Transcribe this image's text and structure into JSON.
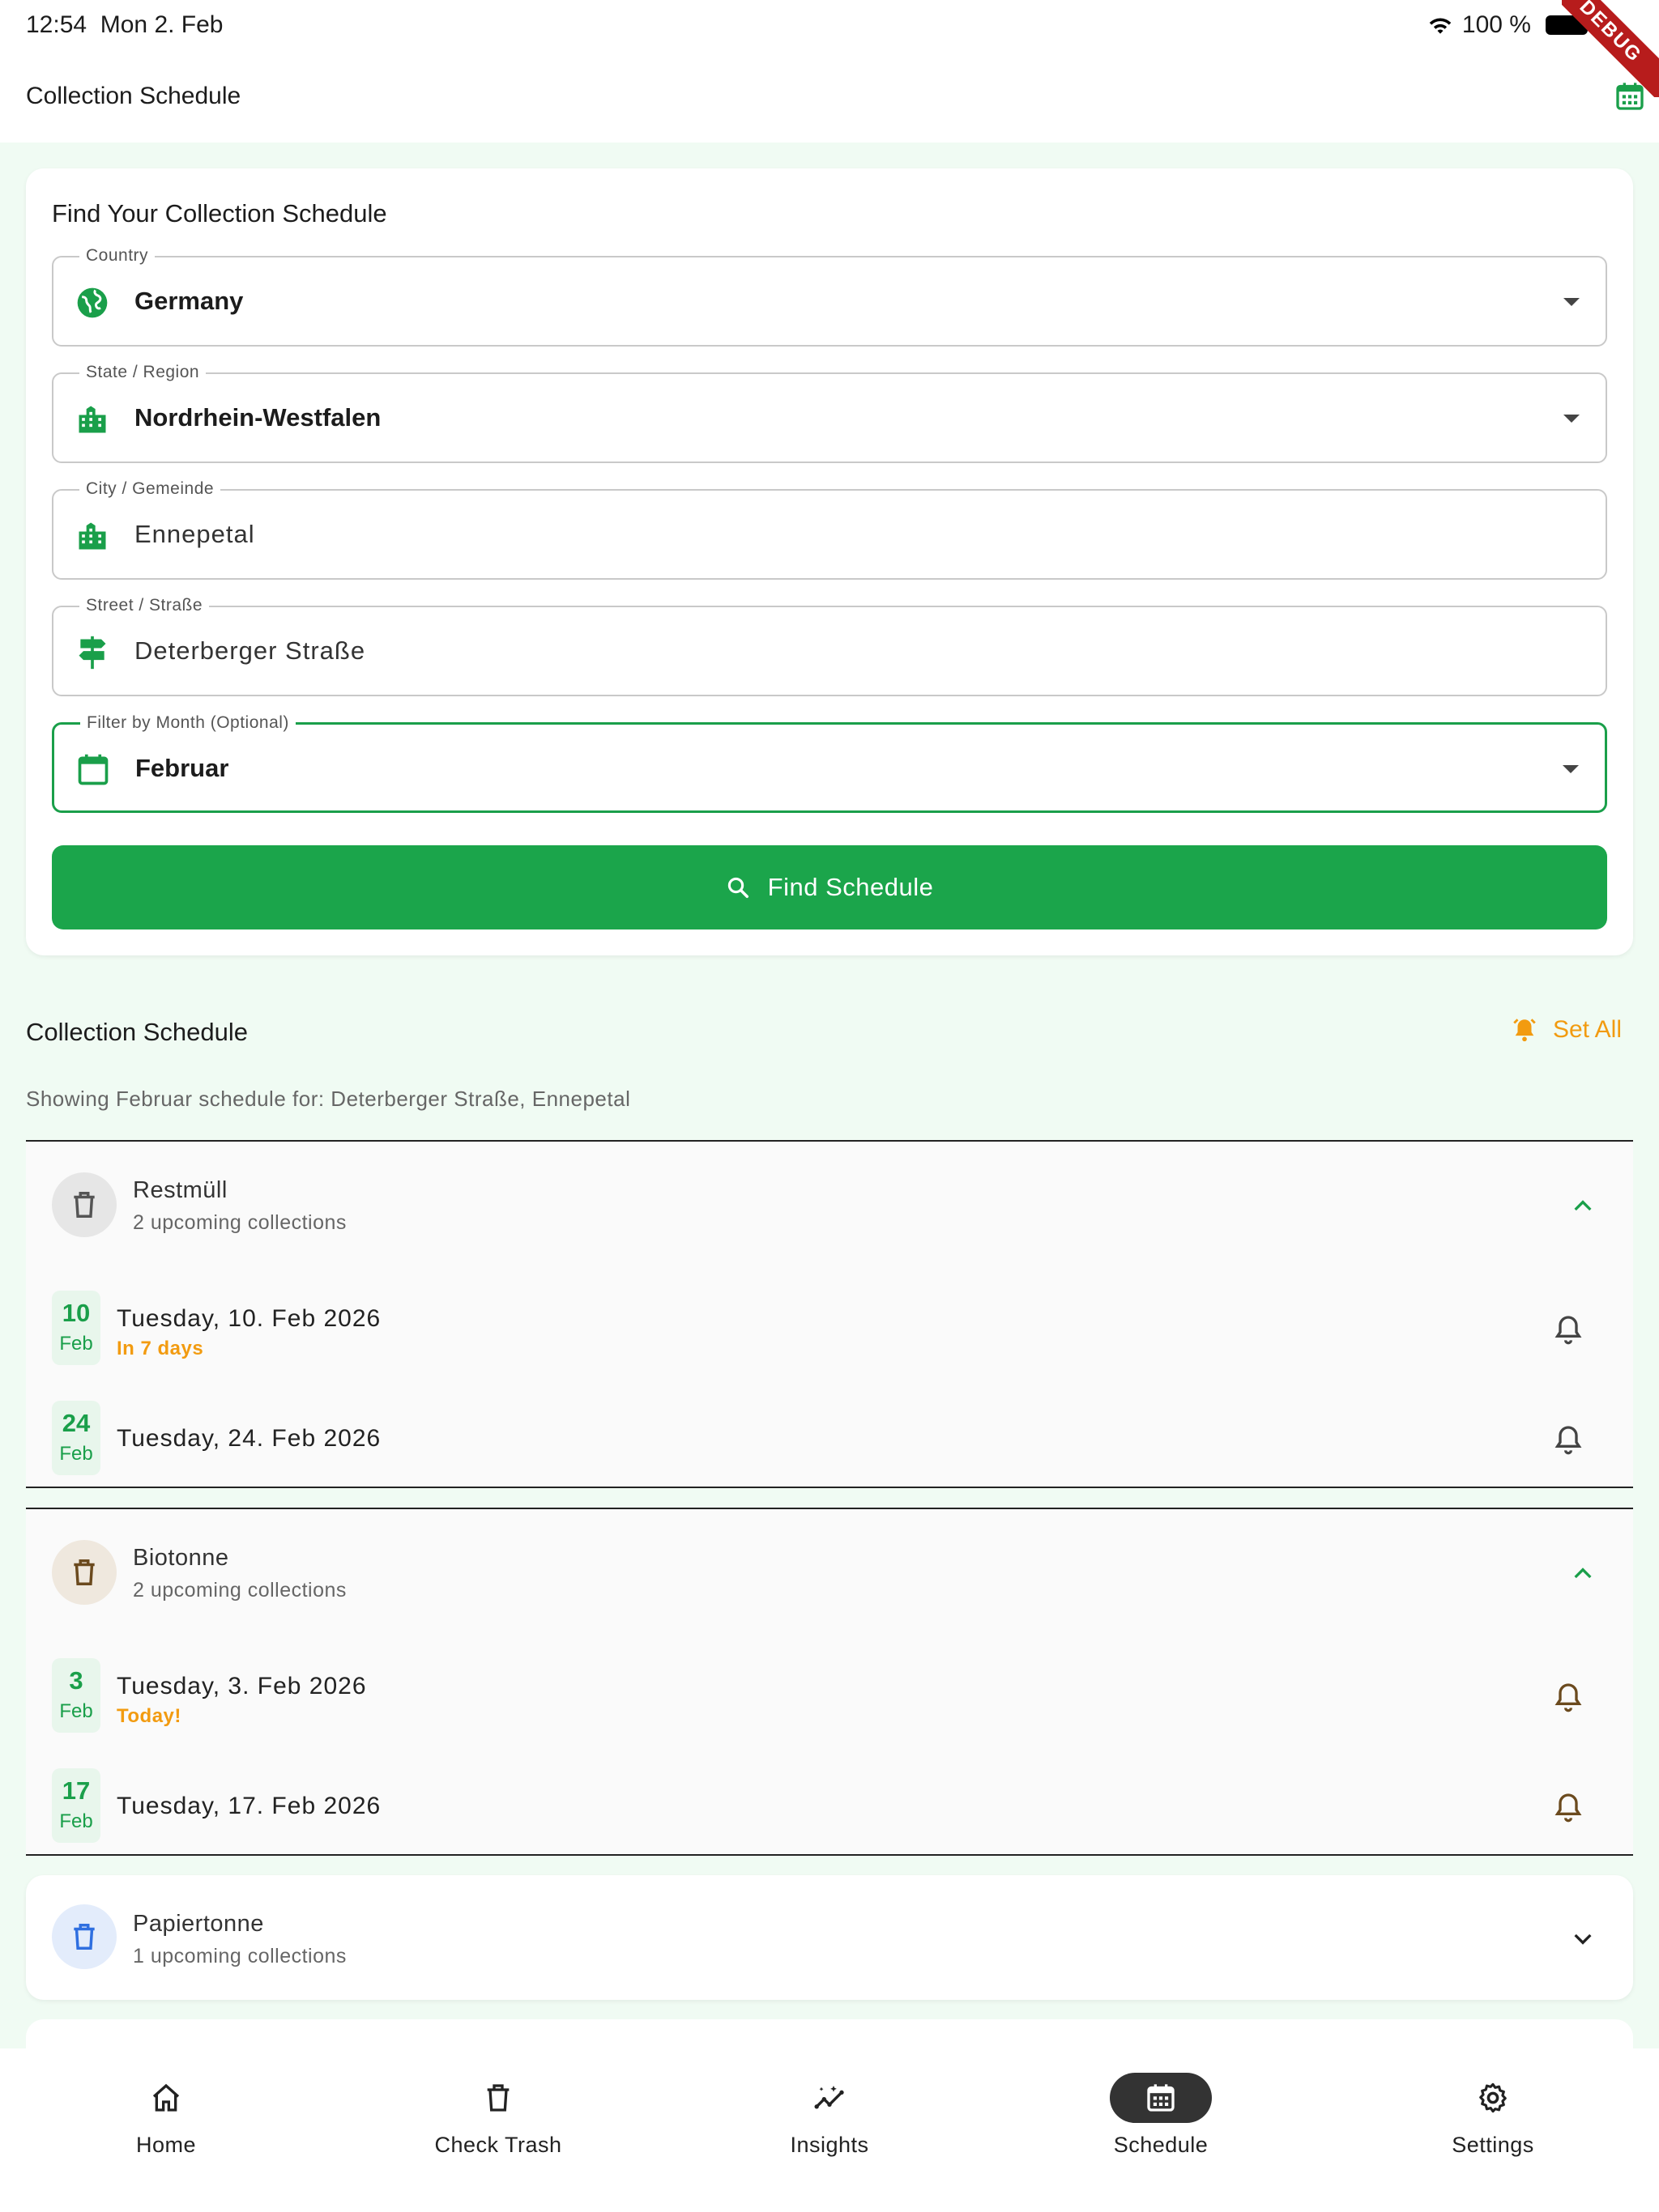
{
  "status_bar": {
    "time": "12:54",
    "date": "Mon 2. Feb",
    "battery": "100 %",
    "debug": "DEBUG"
  },
  "app_bar": {
    "title": "Collection Schedule"
  },
  "find_card": {
    "title": "Find Your Collection Schedule",
    "fields": [
      {
        "label": "Country",
        "value": "Germany",
        "icon": "globe-icon"
      },
      {
        "label": "State / Region",
        "value": "Nordrhein-Westfalen",
        "icon": "city-icon"
      },
      {
        "label": "City / Gemeinde",
        "value": "Ennepetal",
        "icon": "city-icon"
      },
      {
        "label": "Street / Straße",
        "value": "Deterberger Straße",
        "icon": "signpost-icon"
      },
      {
        "label": "Filter by Month (Optional)",
        "value": "Februar",
        "icon": "calendar-icon"
      }
    ],
    "button": "Find Schedule"
  },
  "schedule": {
    "title": "Collection Schedule",
    "set_all": "Set All",
    "subtitle": "Showing Februar schedule for: Deterberger Straße, Ennepetal",
    "groups": [
      {
        "name": "Restmüll",
        "count": "2 upcoming collections",
        "color": "#555555",
        "rows": [
          {
            "day": "10",
            "month": "Feb",
            "date": "Tuesday, 10. Feb 2026",
            "note": "In 7 days"
          },
          {
            "day": "24",
            "month": "Feb",
            "date": "Tuesday, 24. Feb 2026",
            "note": ""
          }
        ]
      },
      {
        "name": "Biotonne",
        "count": "2 upcoming collections",
        "color": "#6b4a1e",
        "rows": [
          {
            "day": "3",
            "month": "Feb",
            "date": "Tuesday, 3. Feb 2026",
            "note": "Today!"
          },
          {
            "day": "17",
            "month": "Feb",
            "date": "Tuesday, 17. Feb 2026",
            "note": ""
          }
        ]
      },
      {
        "name": "Papiertonne",
        "count": "1 upcoming collections",
        "color": "#2f6fe0"
      }
    ]
  },
  "nav": {
    "items": [
      {
        "label": "Home"
      },
      {
        "label": "Check Trash"
      },
      {
        "label": "Insights"
      },
      {
        "label": "Schedule"
      },
      {
        "label": "Settings"
      }
    ]
  },
  "colors": {
    "primary": "#1ba54b",
    "accent": "#f29b10",
    "background": "#f0fbf3"
  }
}
